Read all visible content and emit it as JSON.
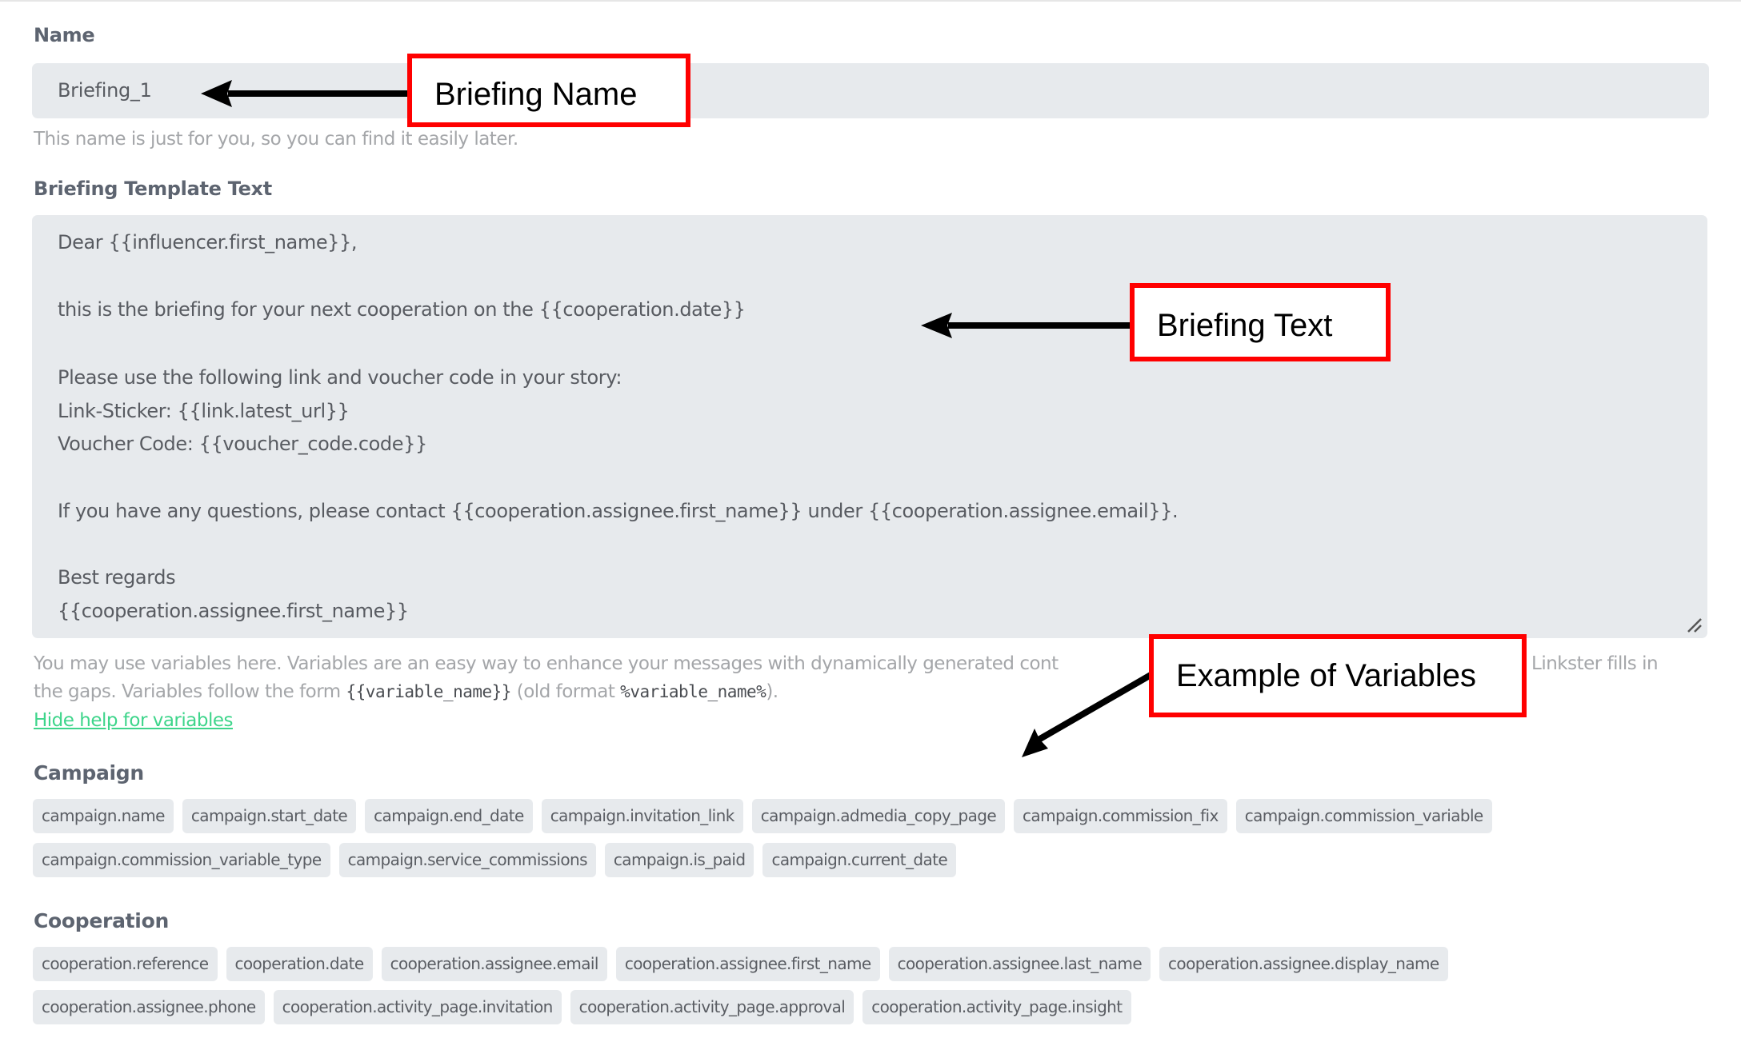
{
  "form": {
    "name_label": "Name",
    "name_value": "Briefing_1",
    "name_help": "This name is just for you, so you can find it easily later.",
    "template_label": "Briefing Template Text",
    "template_lines": [
      "Dear {{influencer.first_name}},",
      "this is the briefing for your next cooperation on the  {{cooperation.date}}",
      "Please use the following link and voucher code in your story:",
      "Link-Sticker: {{link.latest_url}}",
      "Voucher Code: {{voucher_code.code}}",
      "If you have any questions, please contact {{cooperation.assignee.first_name}} under {{cooperation.assignee.email}}.",
      "Best regards",
      "{{cooperation.assignee.first_name}}"
    ],
    "variables_help": {
      "line1_visible_start": "You may use variables here. Variables are an easy way to enhance your messages with dynamically generated cont",
      "line1_visible_end": "Linkster fills in",
      "line2_prefix": "the gaps. Variables follow the form ",
      "line2_code1": "{{variable_name}}",
      "line2_middle": " (old format ",
      "line2_code2": "%variable_name%",
      "line2_suffix": ")."
    },
    "hide_help_link": "Hide help for variables",
    "link_color": "#3ed58b"
  },
  "variables": {
    "campaign": {
      "title": "Campaign",
      "rows": [
        [
          "campaign.name",
          "campaign.start_date",
          "campaign.end_date",
          "campaign.invitation_link",
          "campaign.admedia_copy_page",
          "campaign.commission_fix",
          "campaign.commission_variable"
        ],
        [
          "campaign.commission_variable_type",
          "campaign.service_commissions",
          "campaign.is_paid",
          "campaign.current_date"
        ]
      ]
    },
    "cooperation": {
      "title": "Cooperation",
      "rows": [
        [
          "cooperation.reference",
          "cooperation.date",
          "cooperation.assignee.email",
          "cooperation.assignee.first_name",
          "cooperation.assignee.last_name",
          "cooperation.assignee.display_name"
        ],
        [
          "cooperation.assignee.phone",
          "cooperation.activity_page.invitation",
          "cooperation.activity_page.approval",
          "cooperation.activity_page.insight"
        ]
      ]
    }
  },
  "annotations": {
    "briefing_name": "Briefing Name",
    "briefing_text": "Briefing Text",
    "example_variables": "Example of Variables",
    "box_color": "#ff0000"
  }
}
